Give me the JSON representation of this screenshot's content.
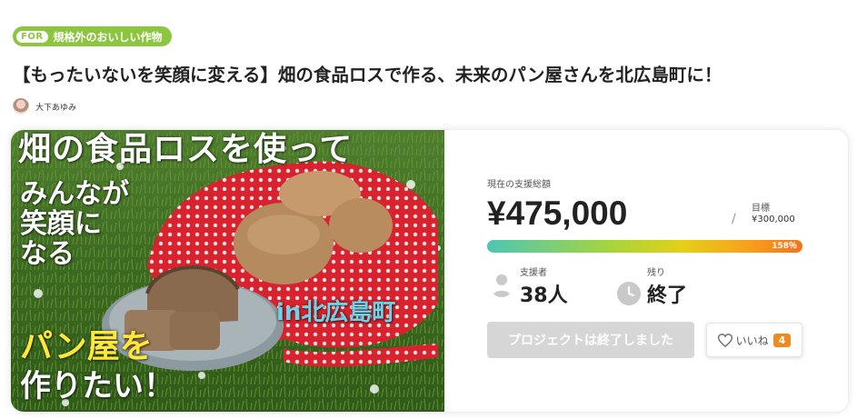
{
  "category": {
    "prefix": "FOR",
    "label": "規格外のおいしい作物",
    "color": "#8cc63f"
  },
  "title": "【もったいないを笑顔に変える】畑の食品ロスで作る、未来のパン屋さんを北広島町に！",
  "author": {
    "name": "大下あゆみ"
  },
  "hero": {
    "line1": "畑の食品ロスを使って",
    "line2": "みんなが",
    "line3": "笑顔に",
    "line4": "なる",
    "line5": "in北広島町",
    "line6": "パン屋を",
    "line7": "作りたい！"
  },
  "funding": {
    "total_label": "現在の支援総額",
    "total_amount": "¥475,000",
    "goal_separator": "/",
    "goal_label": "目標",
    "goal_amount": "¥300,000",
    "progress_text": "158％",
    "progress_fraction": 1.58,
    "bar_colors": [
      "#4ec6b4",
      "#a8d43c",
      "#e4d018",
      "#f7a21e",
      "#f2731c"
    ]
  },
  "stats": {
    "supporters_label": "支援者",
    "supporters_value": "38人",
    "remaining_label": "残り",
    "remaining_value": "終了"
  },
  "actions": {
    "ended_button": "プロジェクトは終了しました",
    "like_label": "いいね",
    "like_count": "4",
    "like_color": "#f08a1f"
  },
  "icons": {
    "supporter": "person-icon",
    "remaining": "clock-icon",
    "like": "heart-icon"
  }
}
